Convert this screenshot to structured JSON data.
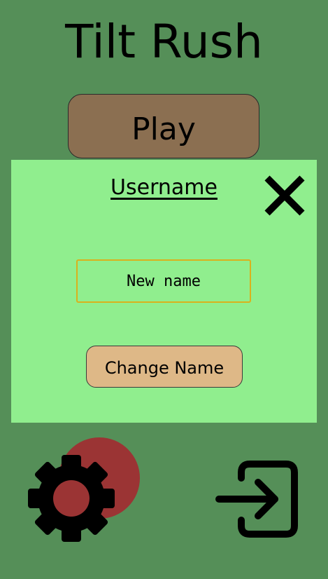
{
  "app": {
    "title": "Tilt Rush"
  },
  "menu": {
    "play_label": "Play"
  },
  "username_dialog": {
    "title": "Username",
    "input_value": "New name",
    "change_button_label": "Change Name",
    "close_icon": "close-icon"
  },
  "bottom_bar": {
    "settings_icon": "gear-icon",
    "login_icon": "login-icon",
    "notification_dot_color": "#9b3434"
  },
  "colors": {
    "background": "#558f58",
    "dialog_background": "#90ee8e",
    "play_button": "#8b6f51",
    "change_button": "#deb887",
    "input_border": "#d9b21c"
  }
}
